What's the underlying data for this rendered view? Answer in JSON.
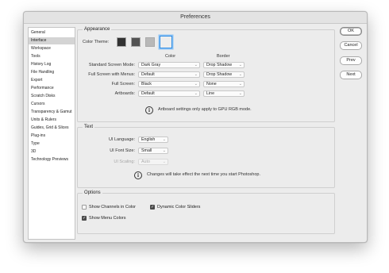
{
  "window": {
    "title": "Preferences"
  },
  "sidebar": {
    "items": [
      {
        "label": "General",
        "selected": false
      },
      {
        "label": "Interface",
        "selected": true
      },
      {
        "label": "Workspace",
        "selected": false
      },
      {
        "label": "Tools",
        "selected": false
      },
      {
        "label": "History Log",
        "selected": false
      },
      {
        "label": "File Handling",
        "selected": false
      },
      {
        "label": "Export",
        "selected": false
      },
      {
        "label": "Performance",
        "selected": false
      },
      {
        "label": "Scratch Disks",
        "selected": false
      },
      {
        "label": "Cursors",
        "selected": false
      },
      {
        "label": "Transparency & Gamut",
        "selected": false
      },
      {
        "label": "Units & Rulers",
        "selected": false
      },
      {
        "label": "Guides, Grid & Slices",
        "selected": false
      },
      {
        "label": "Plug-ins",
        "selected": false
      },
      {
        "label": "Type",
        "selected": false
      },
      {
        "label": "3D",
        "selected": false
      },
      {
        "label": "Technology Previews",
        "selected": false
      }
    ]
  },
  "appearance": {
    "legend": "Appearance",
    "color_theme_label": "Color Theme:",
    "swatches": [
      "#323232",
      "#535353",
      "#b8b8b8",
      "#ededed"
    ],
    "selected_swatch": 3,
    "color_header": "Color",
    "border_header": "Border",
    "rows": [
      {
        "label": "Standard Screen Mode:",
        "color": "Dark Gray",
        "border": "Drop Shadow"
      },
      {
        "label": "Full Screen with Menus:",
        "color": "Default",
        "border": "Drop Shadow"
      },
      {
        "label": "Full Screen:",
        "color": "Black",
        "border": "None"
      },
      {
        "label": "Artboards:",
        "color": "Default",
        "border": "Line"
      }
    ],
    "info": "Artboard settings only apply to GPU RGB mode."
  },
  "text": {
    "legend": "Text",
    "ui_language_label": "UI Language:",
    "ui_language": "English",
    "ui_font_size_label": "UI Font Size:",
    "ui_font_size": "Small",
    "ui_scaling_label": "UI Scaling:",
    "ui_scaling": "Auto",
    "info": "Changes will take effect the next time you start Photoshop."
  },
  "options": {
    "legend": "Options",
    "show_channels_in_color": {
      "label": "Show Channels in Color",
      "checked": false
    },
    "dynamic_color_sliders": {
      "label": "Dynamic Color Sliders",
      "checked": true
    },
    "show_menu_colors": {
      "label": "Show Menu Colors",
      "checked": true
    }
  },
  "buttons": {
    "ok": "OK",
    "cancel": "Cancel",
    "prev": "Prev",
    "next": "Next"
  }
}
